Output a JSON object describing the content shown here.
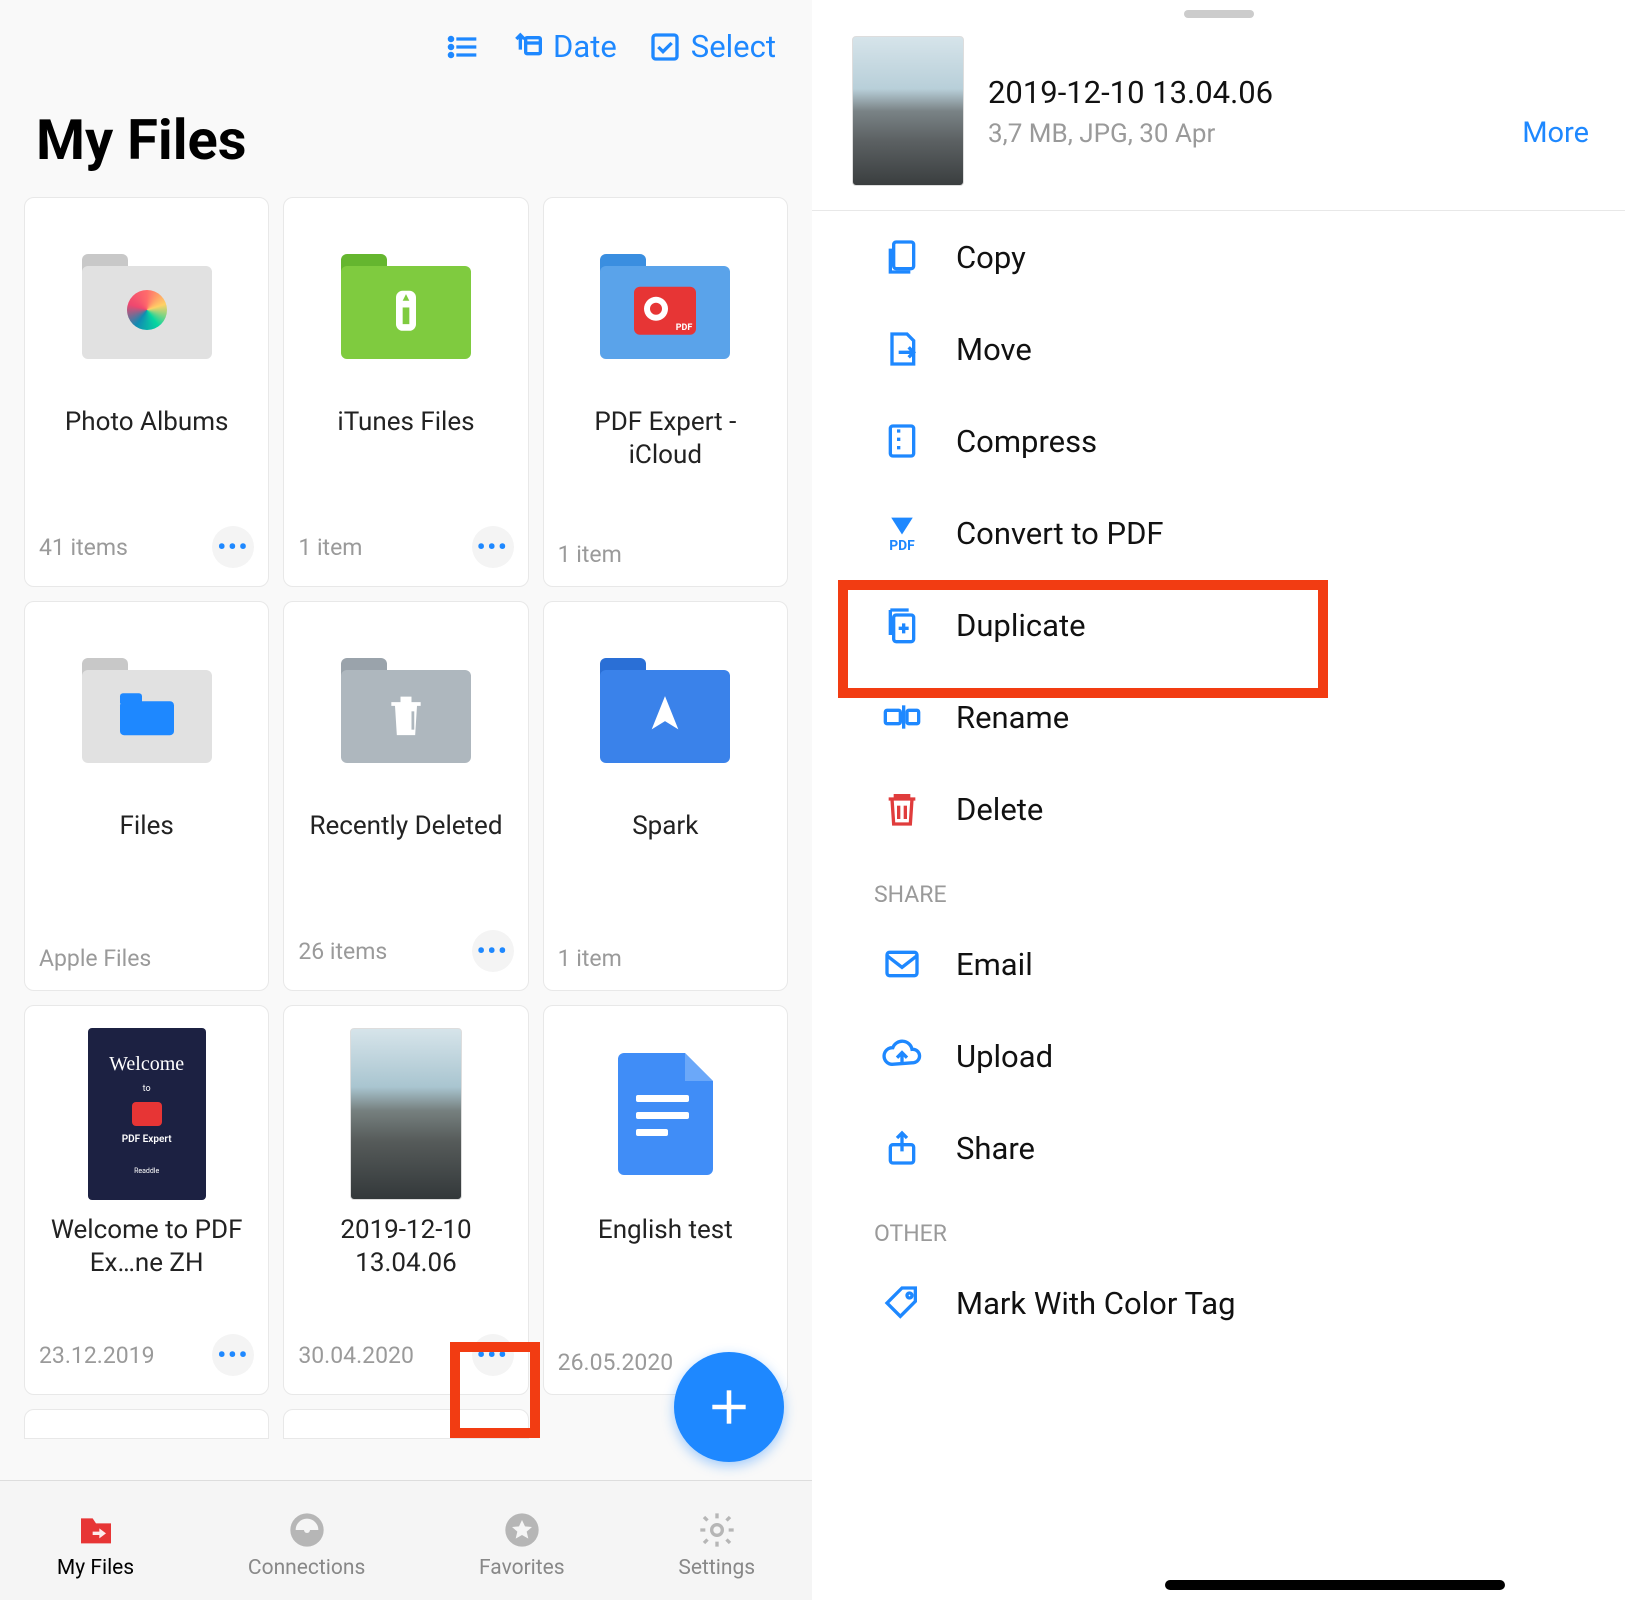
{
  "toolbar": {
    "sort_label": "Date",
    "select_label": "Select"
  },
  "page_title": "My Files",
  "tiles": [
    {
      "name": "Photo Albums",
      "meta": "41 items",
      "more": true
    },
    {
      "name": "iTunes Files",
      "meta": "1 item",
      "more": true
    },
    {
      "name": "PDF Expert - iCloud",
      "meta": "1 item",
      "more": false
    },
    {
      "name": "Files",
      "meta": "Apple Files",
      "more": false
    },
    {
      "name": "Recently Deleted",
      "meta": "26 items",
      "more": true
    },
    {
      "name": "Spark",
      "meta": "1 item",
      "more": false
    },
    {
      "name": "Welcome to PDF Ex…ne ZH",
      "meta": "23.12.2019",
      "more": true
    },
    {
      "name": "2019-12-10 13.04.06",
      "meta": "30.04.2020",
      "more": true
    },
    {
      "name": "English test",
      "meta": "26.05.2020",
      "more": false
    }
  ],
  "tabs": [
    {
      "label": "My Files",
      "active": true
    },
    {
      "label": "Connections",
      "active": false
    },
    {
      "label": "Favorites",
      "active": false
    },
    {
      "label": "Settings",
      "active": false
    }
  ],
  "sheet": {
    "title": "2019-12-10 13.04.06",
    "subtitle": "3,7 MB, JPG, 30 Apr",
    "more_label": "More"
  },
  "actions": [
    {
      "label": "Copy",
      "icon": "copy"
    },
    {
      "label": "Move",
      "icon": "move"
    },
    {
      "label": "Compress",
      "icon": "compress"
    },
    {
      "label": "Convert to PDF",
      "icon": "convert-pdf",
      "highlighted": true
    },
    {
      "label": "Duplicate",
      "icon": "duplicate"
    },
    {
      "label": "Rename",
      "icon": "rename"
    },
    {
      "label": "Delete",
      "icon": "delete"
    }
  ],
  "share_section_label": "SHARE",
  "share_actions": [
    {
      "label": "Email",
      "icon": "email"
    },
    {
      "label": "Upload",
      "icon": "upload"
    },
    {
      "label": "Share",
      "icon": "share"
    }
  ],
  "other_section_label": "OTHER",
  "other_actions": [
    {
      "label": "Mark With Color Tag",
      "icon": "tag"
    }
  ]
}
